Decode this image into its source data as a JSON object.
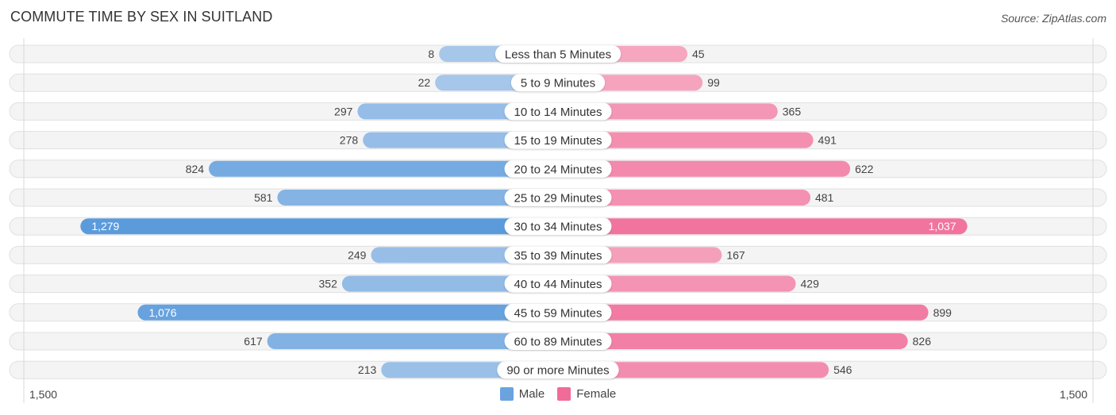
{
  "header": {
    "title": "COMMUTE TIME BY SEX IN SUITLAND",
    "source": "Source: ZipAtlas.com"
  },
  "legend": {
    "male_label": "Male",
    "female_label": "Female",
    "male_color": "#6aa3dd",
    "female_color": "#f06b98"
  },
  "axis": {
    "left_label": "1,500",
    "right_label": "1,500"
  },
  "chart_data": {
    "type": "bar",
    "orientation": "horizontal-diverging",
    "title": "COMMUTE TIME BY SEX IN SUITLAND",
    "categories": [
      "Less than 5 Minutes",
      "5 to 9 Minutes",
      "10 to 14 Minutes",
      "15 to 19 Minutes",
      "20 to 24 Minutes",
      "25 to 29 Minutes",
      "30 to 34 Minutes",
      "35 to 39 Minutes",
      "40 to 44 Minutes",
      "45 to 59 Minutes",
      "60 to 89 Minutes",
      "90 or more Minutes"
    ],
    "series": [
      {
        "name": "Male",
        "side": "left",
        "values": [
          8,
          22,
          297,
          278,
          824,
          581,
          1279,
          249,
          352,
          1076,
          617,
          213
        ],
        "labels": [
          "8",
          "22",
          "297",
          "278",
          "824",
          "581",
          "1,279",
          "249",
          "352",
          "1,076",
          "617",
          "213"
        ]
      },
      {
        "name": "Female",
        "side": "right",
        "values": [
          45,
          99,
          365,
          491,
          622,
          481,
          1037,
          167,
          429,
          899,
          826,
          546
        ],
        "labels": [
          "45",
          "99",
          "365",
          "491",
          "622",
          "481",
          "1,037",
          "167",
          "429",
          "899",
          "826",
          "546"
        ]
      }
    ],
    "xlim": [
      -1500,
      1500
    ],
    "xtick_labels": [
      "1,500",
      "1,500"
    ],
    "legend_position": "bottom-center",
    "grid": false
  }
}
